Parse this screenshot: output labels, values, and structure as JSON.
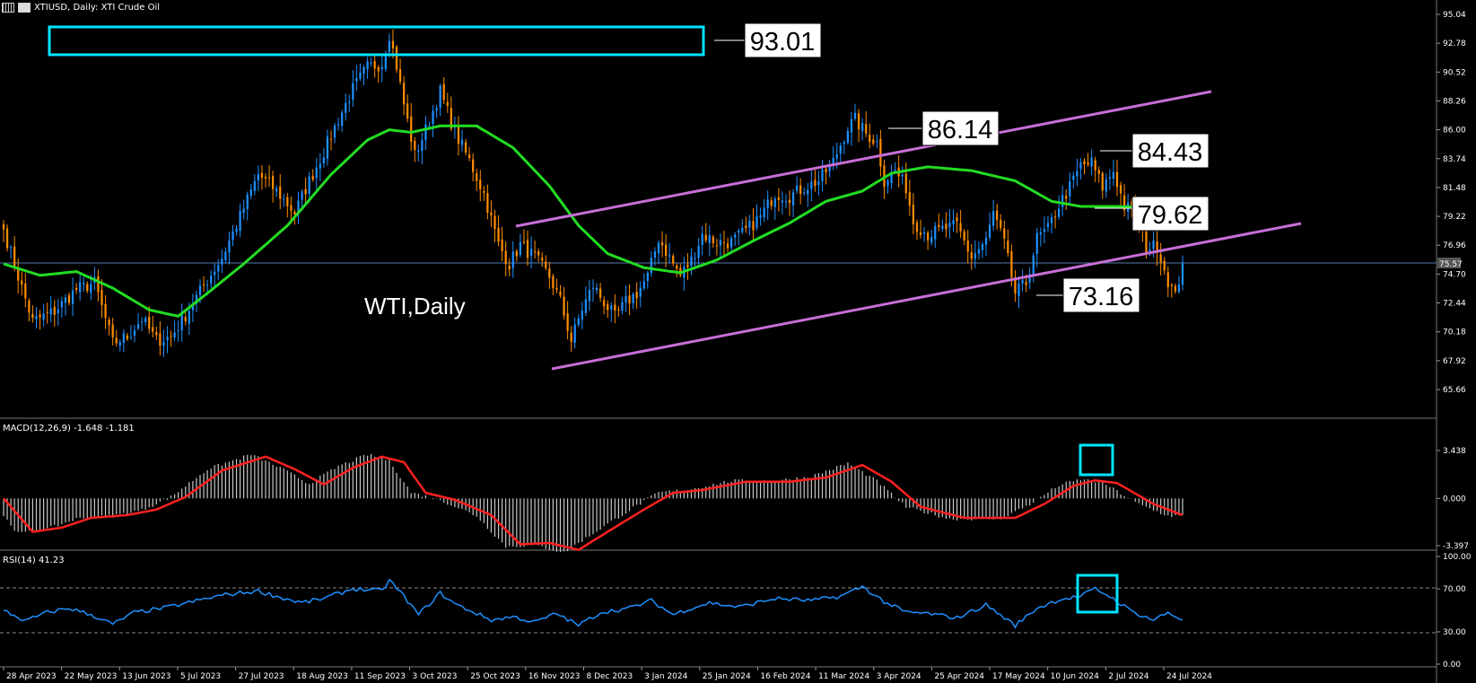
{
  "header": {
    "symbol_text": "XTIUSD, Daily:  XTI Crude Oil"
  },
  "price_panel": {
    "label": "WTI,Daily",
    "current_price": "75.57",
    "yticks": [
      "95.04",
      "92.78",
      "90.52",
      "88.26",
      "86.00",
      "83.74",
      "81.48",
      "79.22",
      "76.96",
      "74.70",
      "72.44",
      "70.18",
      "67.92",
      "65.66"
    ],
    "annotations": [
      "93.01",
      "86.14",
      "84.43",
      "79.62",
      "73.16"
    ]
  },
  "macd_panel": {
    "title": "MACD(12,26,9) -1.648 -1.181",
    "yticks": [
      "3.438",
      "0.000",
      "-3.397"
    ]
  },
  "rsi_panel": {
    "title": "RSI(14) 41.23",
    "yticks": [
      "100.00",
      "70.00",
      "30.00",
      "0.00"
    ]
  },
  "xaxis": {
    "labels": [
      "28 Apr 2023",
      "22 May 2023",
      "13 Jun 2023",
      "5 Jul 2023",
      "27 Jul 2023",
      "18 Aug 2023",
      "11 Sep 2023",
      "3 Oct 2023",
      "25 Oct 2023",
      "16 Nov 2023",
      "8 Dec 2023",
      "3 Jan 2024",
      "25 Jan 2024",
      "16 Feb 2024",
      "11 Mar 2024",
      "3 Apr 2024",
      "25 Apr 2024",
      "17 May 2024",
      "10 Jun 2024",
      "2 Jul 2024",
      "24 Jul 2024"
    ]
  },
  "colors": {
    "background": "#000000",
    "bull_candle": "#1e90ff",
    "bear_candle": "#ff8c00",
    "moving_average": "#22dd22",
    "channel": "#c86ed8",
    "highlight_box": "#00e5ff",
    "macd_signal": "#ff2020",
    "macd_hist": "#c8c8c8",
    "rsi_line": "#1e90ff",
    "grid": "#444444",
    "text": "#ffffff"
  },
  "chart_data": {
    "type": "candlestick",
    "title": "XTIUSD, Daily: XTI Crude Oil",
    "ylim": [
      64.5,
      96.0
    ],
    "price_anchors": [
      [
        0,
        78.2
      ],
      [
        4,
        74.5
      ],
      [
        8,
        71.0
      ],
      [
        14,
        71.8
      ],
      [
        20,
        73.5
      ],
      [
        25,
        74.0
      ],
      [
        30,
        69.3
      ],
      [
        34,
        69.8
      ],
      [
        38,
        71.2
      ],
      [
        42,
        69.5
      ],
      [
        46,
        69.8
      ],
      [
        50,
        71.5
      ],
      [
        55,
        73.8
      ],
      [
        60,
        76.0
      ],
      [
        65,
        79.2
      ],
      [
        70,
        82.5
      ],
      [
        75,
        81.2
      ],
      [
        80,
        79.5
      ],
      [
        84,
        82.0
      ],
      [
        88,
        84.3
      ],
      [
        92,
        86.8
      ],
      [
        96,
        89.2
      ],
      [
        100,
        90.9
      ],
      [
        104,
        91.2
      ],
      [
        106,
        93.5
      ],
      [
        108,
        91.0
      ],
      [
        110,
        88.0
      ],
      [
        113,
        84.0
      ],
      [
        116,
        86.0
      ],
      [
        120,
        89.0
      ],
      [
        124,
        85.8
      ],
      [
        128,
        83.6
      ],
      [
        132,
        81.0
      ],
      [
        136,
        77.0
      ],
      [
        139,
        75.5
      ],
      [
        142,
        77.0
      ],
      [
        146,
        76.0
      ],
      [
        150,
        74.5
      ],
      [
        153,
        72.6
      ],
      [
        156,
        69.5
      ],
      [
        159,
        72.0
      ],
      [
        162,
        73.8
      ],
      [
        165,
        72.5
      ],
      [
        168,
        71.3
      ],
      [
        171,
        72.5
      ],
      [
        174,
        73.2
      ],
      [
        177,
        74.5
      ],
      [
        180,
        77.5
      ],
      [
        184,
        75.5
      ],
      [
        186,
        74.6
      ],
      [
        189,
        75.8
      ],
      [
        192,
        77.8
      ],
      [
        196,
        77.2
      ],
      [
        200,
        77.2
      ],
      [
        204,
        78.1
      ],
      [
        208,
        79.2
      ],
      [
        212,
        81.0
      ],
      [
        216,
        80.8
      ],
      [
        220,
        81.5
      ],
      [
        224,
        82.0
      ],
      [
        228,
        83.5
      ],
      [
        232,
        86.2
      ],
      [
        234,
        86.8
      ],
      [
        237,
        85.7
      ],
      [
        240,
        85.0
      ],
      [
        242,
        82.0
      ],
      [
        245,
        82.8
      ],
      [
        248,
        81.5
      ],
      [
        250,
        78.8
      ],
      [
        254,
        77.8
      ],
      [
        258,
        78.2
      ],
      [
        262,
        78.5
      ],
      [
        266,
        76.0
      ],
      [
        270,
        77.3
      ],
      [
        272,
        79.5
      ],
      [
        275,
        77.1
      ],
      [
        278,
        73.2
      ],
      [
        281,
        74.0
      ],
      [
        284,
        77.5
      ],
      [
        287,
        78.2
      ],
      [
        290,
        80.1
      ],
      [
        293,
        81.5
      ],
      [
        296,
        83.2
      ],
      [
        299,
        83.4
      ],
      [
        302,
        81.5
      ],
      [
        305,
        82.8
      ],
      [
        308,
        80.0
      ],
      [
        311,
        79.6
      ],
      [
        314,
        76.8
      ],
      [
        317,
        76.9
      ],
      [
        320,
        74.2
      ],
      [
        322,
        72.9
      ],
      [
        324,
        75.6
      ]
    ],
    "ma_anchors": [
      [
        0,
        75.5
      ],
      [
        10,
        74.6
      ],
      [
        20,
        74.9
      ],
      [
        30,
        73.6
      ],
      [
        40,
        71.9
      ],
      [
        48,
        71.4
      ],
      [
        56,
        73.2
      ],
      [
        66,
        75.5
      ],
      [
        78,
        78.5
      ],
      [
        90,
        82.5
      ],
      [
        100,
        85.2
      ],
      [
        106,
        86.0
      ],
      [
        112,
        85.8
      ],
      [
        120,
        86.3
      ],
      [
        130,
        86.3
      ],
      [
        140,
        84.6
      ],
      [
        150,
        81.6
      ],
      [
        158,
        78.5
      ],
      [
        166,
        76.3
      ],
      [
        176,
        75.2
      ],
      [
        186,
        74.8
      ],
      [
        196,
        75.8
      ],
      [
        206,
        77.3
      ],
      [
        216,
        78.7
      ],
      [
        226,
        80.4
      ],
      [
        236,
        81.2
      ],
      [
        244,
        82.6
      ],
      [
        254,
        83.1
      ],
      [
        266,
        82.8
      ],
      [
        278,
        82.0
      ],
      [
        288,
        80.4
      ],
      [
        296,
        80.0
      ],
      [
        306,
        80.0
      ],
      [
        316,
        79.9
      ],
      [
        324,
        79.5
      ]
    ],
    "macd_signal_anchors": [
      [
        0,
        0.0
      ],
      [
        8,
        -2.4
      ],
      [
        16,
        -2.1
      ],
      [
        24,
        -1.4
      ],
      [
        34,
        -1.2
      ],
      [
        42,
        -0.8
      ],
      [
        50,
        0.1
      ],
      [
        60,
        2.0
      ],
      [
        72,
        3.0
      ],
      [
        80,
        2.1
      ],
      [
        88,
        1.0
      ],
      [
        96,
        2.2
      ],
      [
        104,
        3.0
      ],
      [
        110,
        2.6
      ],
      [
        116,
        0.4
      ],
      [
        124,
        -0.1
      ],
      [
        134,
        -1.2
      ],
      [
        142,
        -3.3
      ],
      [
        150,
        -3.2
      ],
      [
        158,
        -3.7
      ],
      [
        166,
        -2.4
      ],
      [
        176,
        -0.8
      ],
      [
        184,
        0.4
      ],
      [
        192,
        0.6
      ],
      [
        204,
        1.2
      ],
      [
        216,
        1.2
      ],
      [
        226,
        1.5
      ],
      [
        236,
        2.4
      ],
      [
        244,
        1.2
      ],
      [
        252,
        -0.6
      ],
      [
        264,
        -1.4
      ],
      [
        278,
        -1.4
      ],
      [
        286,
        -0.4
      ],
      [
        294,
        0.9
      ],
      [
        300,
        1.3
      ],
      [
        306,
        1.1
      ],
      [
        316,
        -0.4
      ],
      [
        324,
        -1.2
      ]
    ],
    "rsi_anchors": [
      [
        0,
        50
      ],
      [
        6,
        40
      ],
      [
        12,
        48
      ],
      [
        18,
        52
      ],
      [
        24,
        46
      ],
      [
        30,
        37
      ],
      [
        36,
        48
      ],
      [
        44,
        52
      ],
      [
        52,
        58
      ],
      [
        60,
        64
      ],
      [
        70,
        68
      ],
      [
        76,
        62
      ],
      [
        82,
        57
      ],
      [
        88,
        61
      ],
      [
        96,
        70
      ],
      [
        104,
        68
      ],
      [
        106,
        78
      ],
      [
        110,
        63
      ],
      [
        114,
        46
      ],
      [
        120,
        66
      ],
      [
        124,
        56
      ],
      [
        128,
        50
      ],
      [
        134,
        41
      ],
      [
        140,
        44
      ],
      [
        146,
        39
      ],
      [
        152,
        47
      ],
      [
        158,
        36
      ],
      [
        164,
        48
      ],
      [
        172,
        52
      ],
      [
        178,
        59
      ],
      [
        184,
        46
      ],
      [
        188,
        51
      ],
      [
        194,
        57
      ],
      [
        202,
        53
      ],
      [
        212,
        61
      ],
      [
        222,
        59
      ],
      [
        230,
        63
      ],
      [
        236,
        72
      ],
      [
        242,
        58
      ],
      [
        248,
        48
      ],
      [
        254,
        47
      ],
      [
        262,
        43
      ],
      [
        270,
        55
      ],
      [
        278,
        36
      ],
      [
        284,
        52
      ],
      [
        290,
        60
      ],
      [
        296,
        63
      ],
      [
        300,
        70
      ],
      [
        304,
        63
      ],
      [
        310,
        49
      ],
      [
        316,
        41
      ],
      [
        320,
        48
      ],
      [
        324,
        41
      ]
    ]
  }
}
